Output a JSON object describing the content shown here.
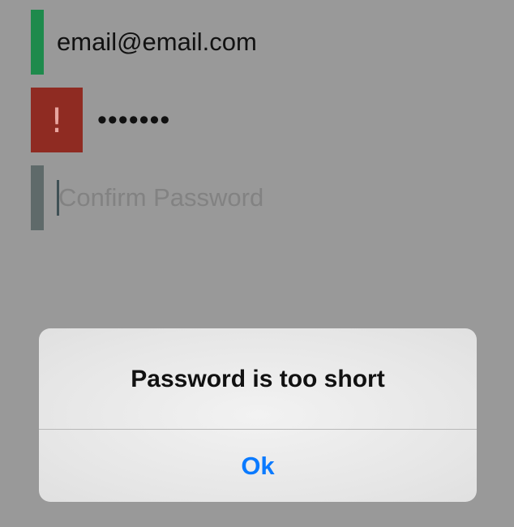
{
  "form": {
    "email": {
      "value": "email@email.com",
      "status_color": "#1e8a4c"
    },
    "password": {
      "value": "•••••••",
      "error_icon": "!",
      "error_color": "#8f2b22"
    },
    "confirm_password": {
      "value": "",
      "placeholder": "Confirm Password",
      "status_color": "#5f6a6a"
    }
  },
  "alert": {
    "title": "Password is too short",
    "button_label": "Ok",
    "button_color": "#0a7aff"
  }
}
